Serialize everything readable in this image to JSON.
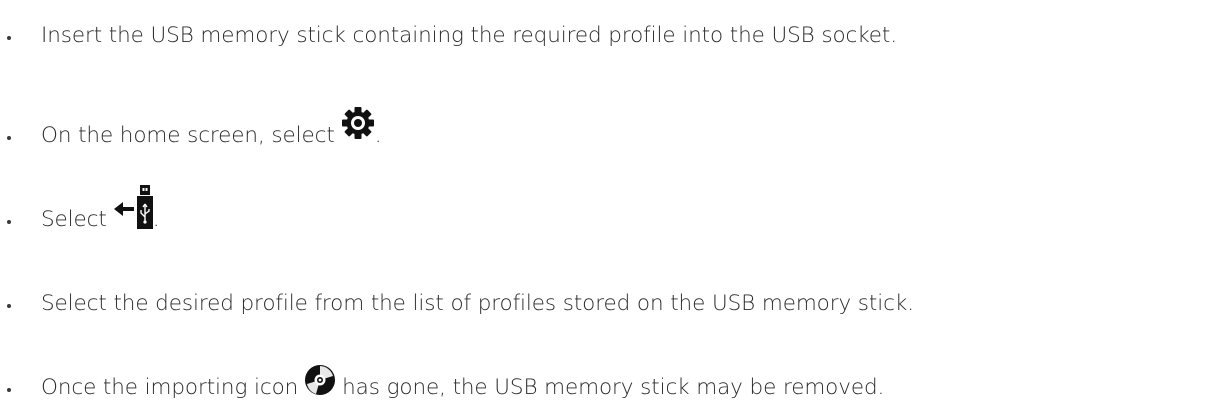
{
  "steps": [
    {
      "text": "Insert the USB memory stick containing the required profile into the USB socket."
    },
    {
      "before": "On the home screen, select",
      "icon": "gear-icon",
      "after": "."
    },
    {
      "before": "Select",
      "icon": "usb-import-icon",
      "after": "."
    },
    {
      "text": "Select the desired profile from the list of profiles stored on the USB memory stick."
    },
    {
      "before": "Once the importing icon",
      "icon": "disc-icon",
      "after": "has gone, the USB memory stick may be removed."
    }
  ],
  "colors": {
    "text": "#2a2a2a",
    "icon": "#111111"
  }
}
